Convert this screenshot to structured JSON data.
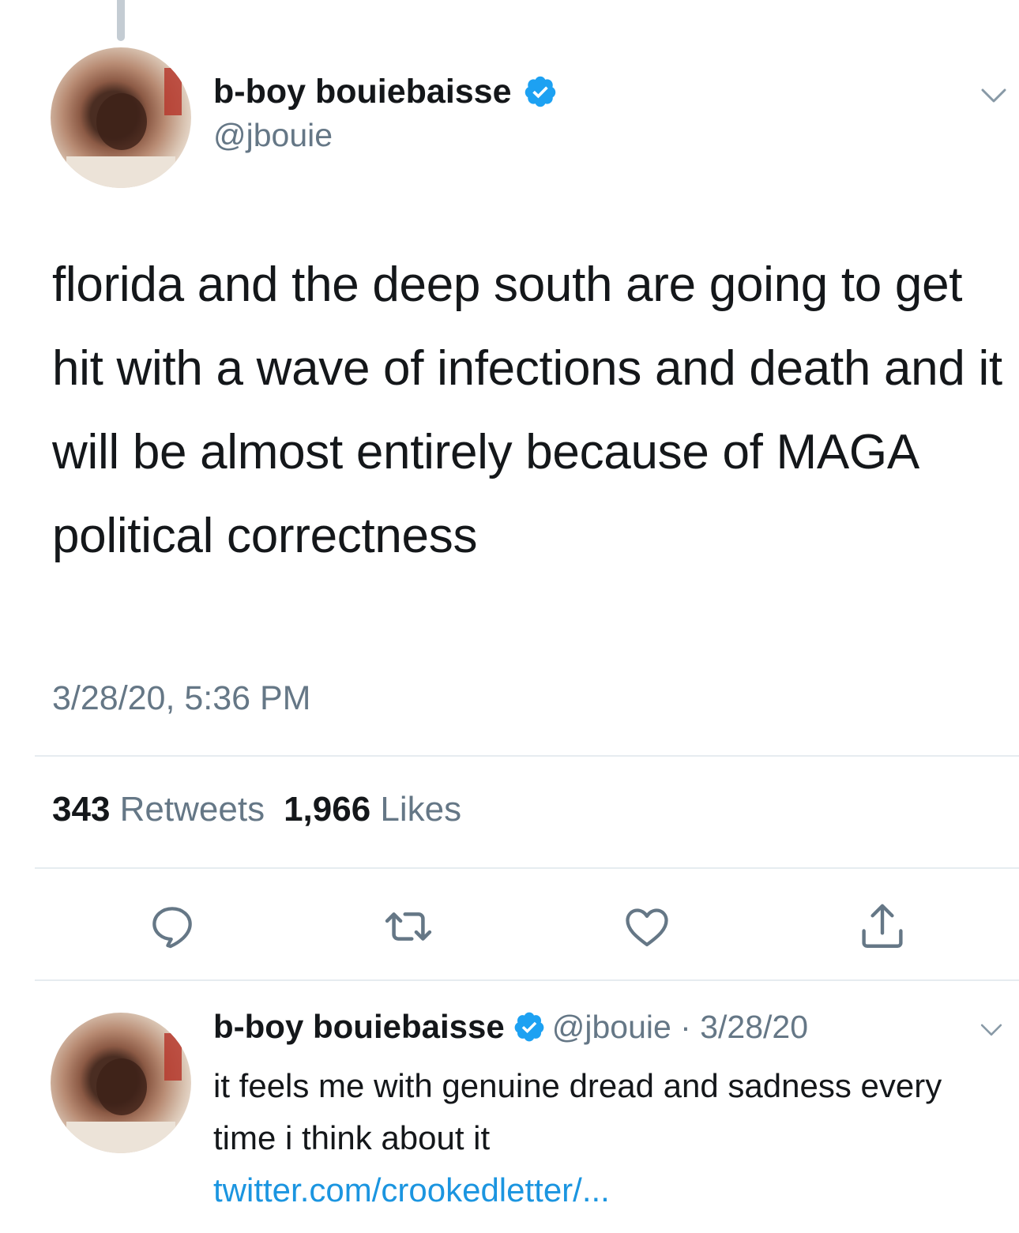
{
  "main_tweet": {
    "author": {
      "display_name": "b-boy bouiebaisse",
      "handle": "@jbouie",
      "verified": true
    },
    "text": "florida and the deep south are going to get hit with a wave of infections and death and it will be almost entirely because of MAGA political correctness",
    "timestamp": "3/28/20, 5:36 PM",
    "stats": {
      "retweets_count": "343",
      "retweets_label": "Retweets",
      "likes_count": "1,966",
      "likes_label": "Likes"
    }
  },
  "actions": {
    "reply_icon": "reply-icon",
    "retweet_icon": "retweet-icon",
    "like_icon": "heart-icon",
    "share_icon": "share-icon"
  },
  "reply_tweet": {
    "author": {
      "display_name": "b-boy bouiebaisse",
      "handle_and_date": "@jbouie · 3/28/20",
      "verified": true
    },
    "text": "it feels me with genuine dread and sadness every time i think about it",
    "link": "twitter.com/crookedletter/..."
  },
  "colors": {
    "text": "#14171a",
    "secondary": "#657786",
    "verified": "#1da1f2",
    "link": "#1b95e0",
    "divider": "#e6ecf0"
  }
}
